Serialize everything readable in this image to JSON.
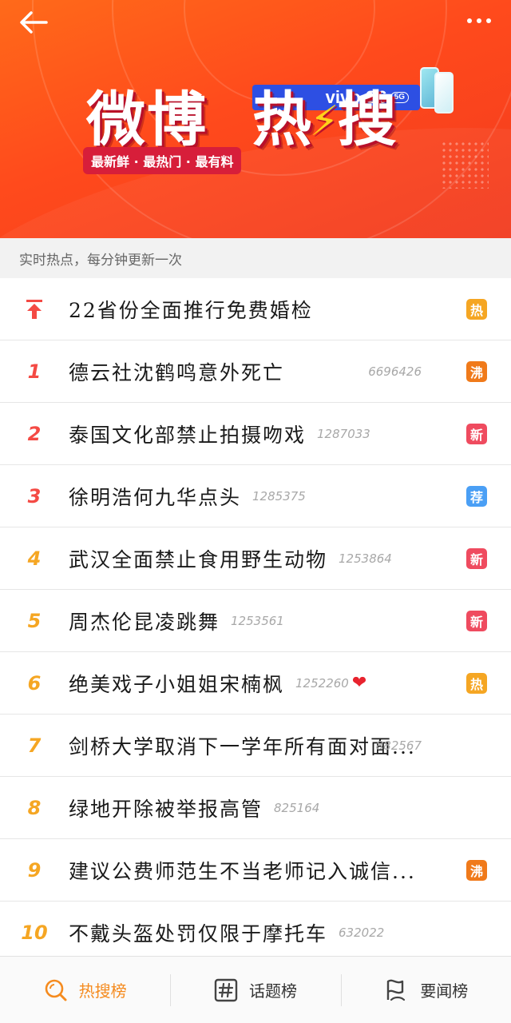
{
  "banner": {
    "logo_text_left": "微博",
    "logo_text_right": "热",
    "logo_text_last": "搜",
    "tagline": "最新鲜 · 最热门 · 最有料",
    "sponsor": "vivo S6",
    "sponsor_5g": "5G",
    "colors": {
      "bg": "#ff4a1c",
      "logo_red": "#d71e3a",
      "bolt": "#ffd21a",
      "sponsor_blue": "#2d4fe3"
    }
  },
  "subtitle": "实时热点，每分钟更新一次",
  "rows": [
    {
      "rank": "",
      "title": "22省份全面推行免费婚检",
      "count": "",
      "badge": "热",
      "badge_color": "#f5a623",
      "pinned": true
    },
    {
      "rank": "1",
      "title": "德云社沈鹤鸣意外死亡",
      "count": "6696426",
      "badge": "沸",
      "badge_color": "#f07a1a"
    },
    {
      "rank": "2",
      "title": "泰国文化部禁止拍摄吻戏",
      "count": "1287033",
      "badge": "新",
      "badge_color": "#ef4b5f"
    },
    {
      "rank": "3",
      "title": "徐明浩何九华点头",
      "count": "1285375",
      "badge": "荐",
      "badge_color": "#4a9ff5"
    },
    {
      "rank": "4",
      "title": "武汉全面禁止食用野生动物",
      "count": "1253864",
      "badge": "新",
      "badge_color": "#ef4b5f"
    },
    {
      "rank": "5",
      "title": "周杰伦昆凌跳舞",
      "count": "1253561",
      "badge": "新",
      "badge_color": "#ef4b5f"
    },
    {
      "rank": "6",
      "title": "绝美戏子小姐姐宋楠枫",
      "count": "1252260",
      "badge": "热",
      "badge_color": "#f5a623",
      "heart": "❤"
    },
    {
      "rank": "7",
      "title": "剑桥大学取消下一学年所有面对面...",
      "count": "882567",
      "badge": "",
      "badge_color": ""
    },
    {
      "rank": "8",
      "title": "绿地开除被举报高管",
      "count": "825164",
      "badge": "",
      "badge_color": ""
    },
    {
      "rank": "9",
      "title": "建议公费师范生不当老师记入诚信...",
      "count": "",
      "badge": "沸",
      "badge_color": "#f07a1a"
    },
    {
      "rank": "10",
      "title": "不戴头盔处罚仅限于摩托车",
      "count": "632022",
      "badge": "",
      "badge_color": ""
    }
  ],
  "tabs": [
    {
      "label": "热搜榜",
      "icon": "search-icon",
      "active": true
    },
    {
      "label": "话题榜",
      "icon": "hashtag-icon",
      "active": false
    },
    {
      "label": "要闻榜",
      "icon": "flag-icon",
      "active": false
    }
  ],
  "accent_color": "#f58b1f"
}
